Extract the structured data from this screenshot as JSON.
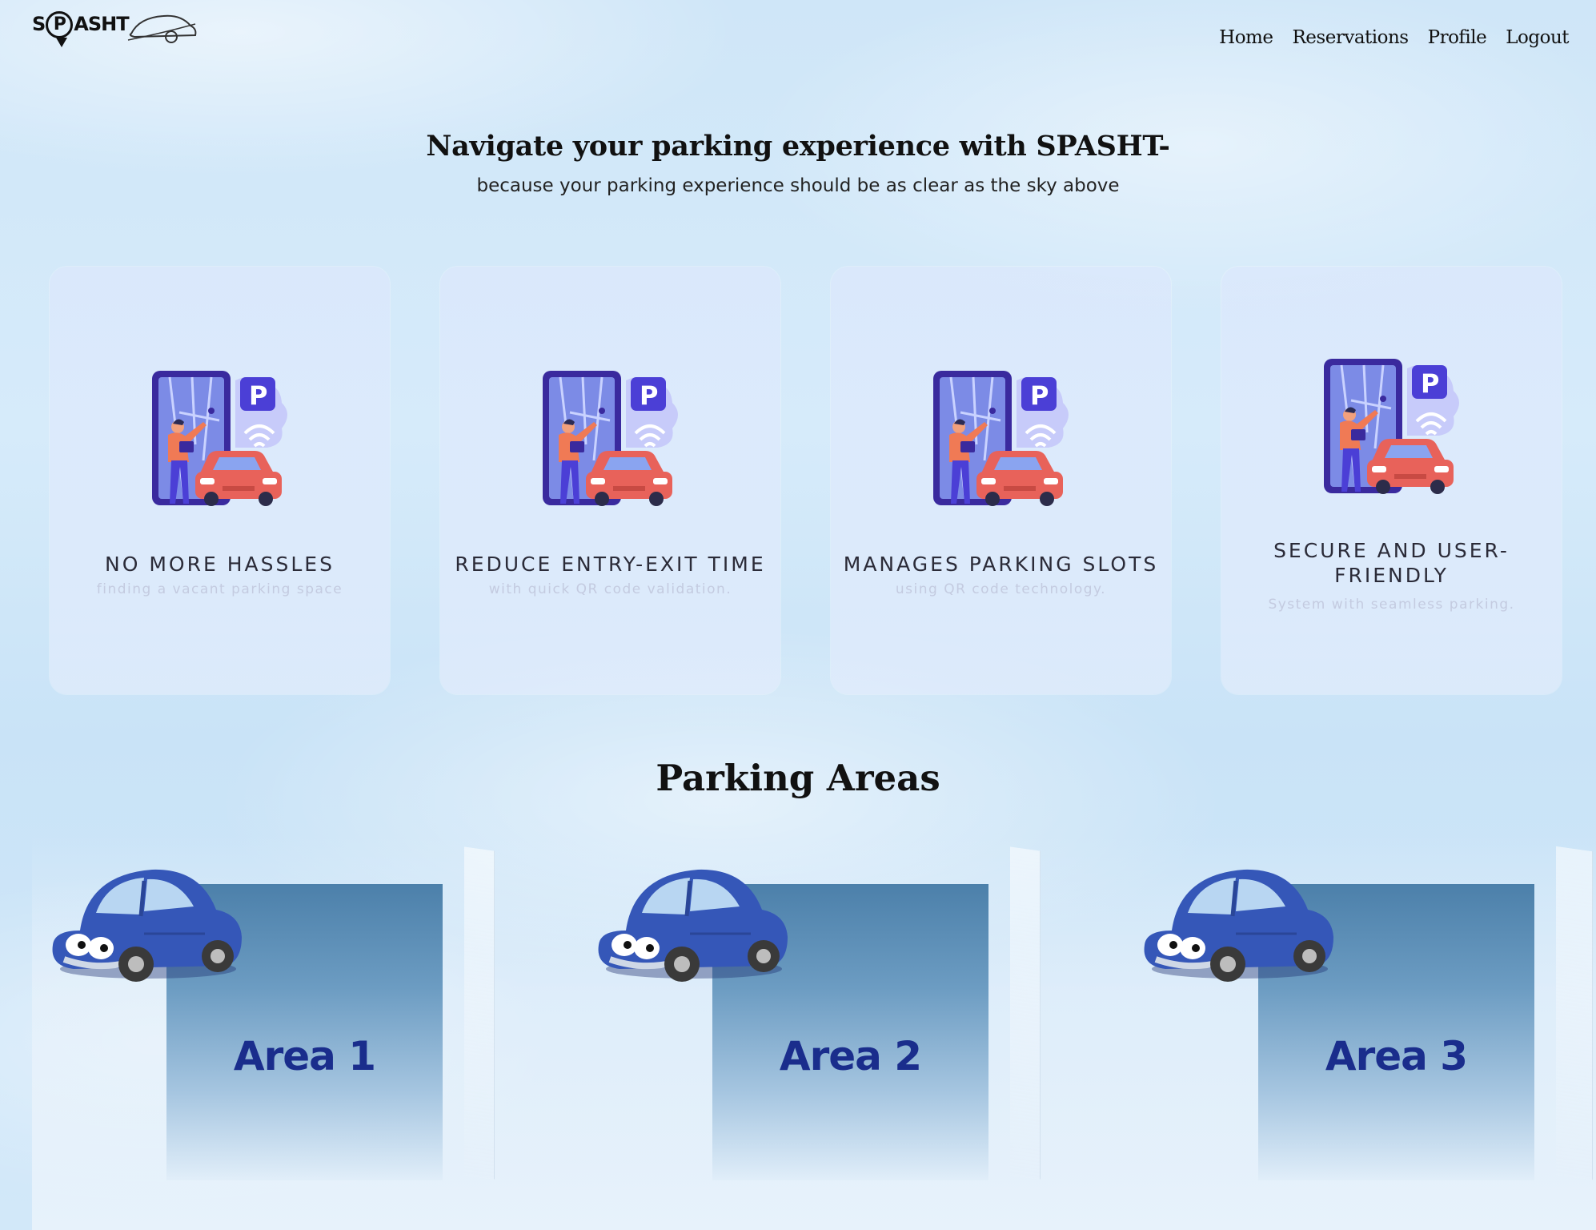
{
  "brand": {
    "name_s": "S",
    "name_p": "P",
    "name_rest": "ASHT"
  },
  "nav": [
    {
      "label": "Home"
    },
    {
      "label": "Reservations"
    },
    {
      "label": "Profile"
    },
    {
      "label": "Logout"
    }
  ],
  "hero": {
    "title": "Navigate your parking experience with SPASHT-",
    "subtitle": "because your parking experience should be as clear as the sky above"
  },
  "features": [
    {
      "title": "NO MORE HASSLES",
      "desc": "finding a vacant parking space",
      "icon": "smart-parking-illustration"
    },
    {
      "title": "REDUCE ENTRY-EXIT TIME",
      "desc": "with quick QR code validation.",
      "icon": "smart-parking-illustration"
    },
    {
      "title": "MANAGES PARKING SLOTS",
      "desc": "using QR code technology.",
      "icon": "smart-parking-illustration"
    },
    {
      "title": "SECURE AND USER-FRIENDLY",
      "desc": "System with seamless parking.",
      "icon": "smart-parking-illustration"
    }
  ],
  "areas_section": {
    "title": "Parking Areas",
    "areas": [
      {
        "label": "Area 1",
        "icon": "blue-car-illustration"
      },
      {
        "label": "Area 2",
        "icon": "blue-car-illustration"
      },
      {
        "label": "Area 3",
        "icon": "blue-car-illustration"
      }
    ]
  },
  "colors": {
    "accent_purple": "#4b3fd6",
    "car_red": "#e8625a",
    "area_label": "#1a2d8c",
    "car_blue": "#3557b8"
  }
}
